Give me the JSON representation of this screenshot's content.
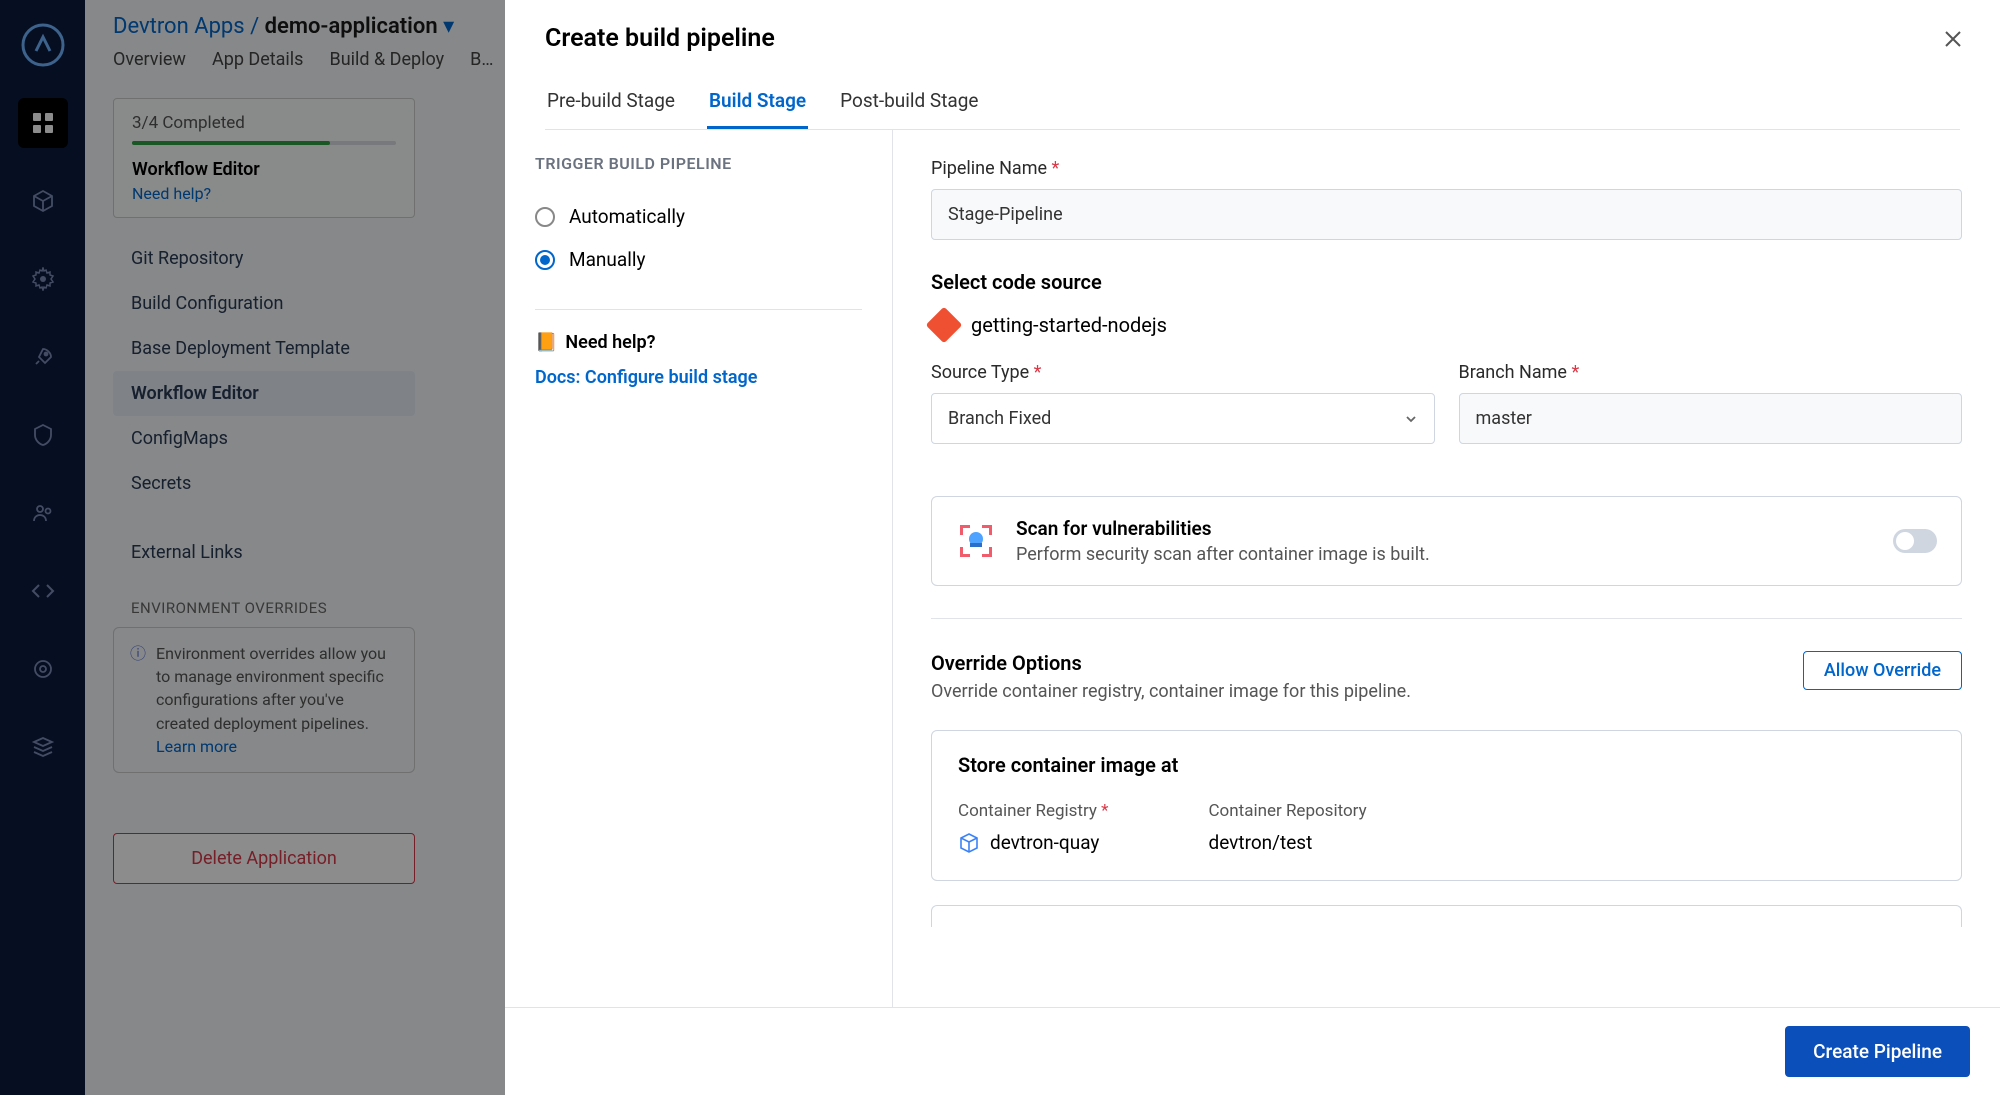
{
  "breadcrumb": {
    "root": "Devtron Apps",
    "leaf": "demo-application"
  },
  "bg_tabs": [
    "Overview",
    "App Details",
    "Build & Deploy",
    "B…"
  ],
  "progress": {
    "status": "3/4 Completed",
    "title": "Workflow Editor",
    "help": "Need help?"
  },
  "bg_nav": {
    "items": [
      "Git Repository",
      "Build Configuration",
      "Base Deployment Template",
      "Workflow Editor",
      "ConfigMaps",
      "Secrets",
      "External Links"
    ],
    "selected": 3
  },
  "env_block": {
    "heading": "ENVIRONMENT OVERRIDES",
    "text": "Environment overrides allow you to manage environment specific configurations after you've created deployment pipelines.",
    "more": "Learn more"
  },
  "delete_label": "Delete Application",
  "modal": {
    "title": "Create build pipeline",
    "tabs": [
      "Pre-build Stage",
      "Build Stage",
      "Post-build Stage"
    ],
    "active_tab": 1,
    "left": {
      "section": "TRIGGER BUILD PIPELINE",
      "opt_auto": "Automatically",
      "opt_manual": "Manually",
      "help_head": "Need help?",
      "docs": "Docs: Configure build stage"
    },
    "right": {
      "pipeline_label": "Pipeline Name",
      "pipeline_value": "Stage-Pipeline",
      "source_title": "Select code source",
      "repo": "getting-started-nodejs",
      "source_type_label": "Source Type",
      "source_type_value": "Branch Fixed",
      "branch_label": "Branch Name",
      "branch_value": "master",
      "scan_title": "Scan for vulnerabilities",
      "scan_sub": "Perform security scan after container image is built.",
      "override_title": "Override Options",
      "override_sub": "Override container registry, container image for this pipeline.",
      "override_btn": "Allow Override",
      "store_title": "Store container image at",
      "registry_label": "Container Registry",
      "registry_value": "devtron-quay",
      "repo_label": "Container Repository",
      "repo_value": "devtron/test"
    },
    "submit": "Create Pipeline"
  }
}
